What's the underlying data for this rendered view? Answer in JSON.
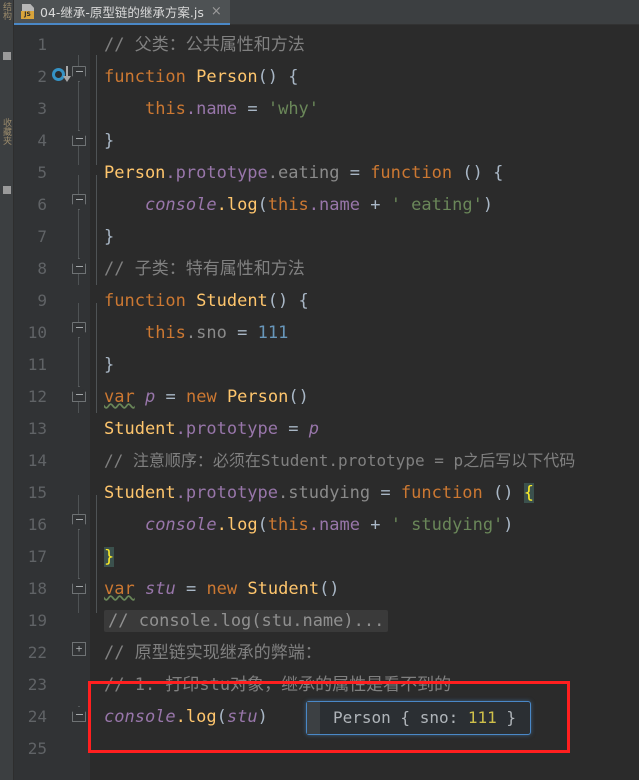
{
  "window": {
    "background": "#2b2b2b",
    "accent": "#4a88c7"
  },
  "left_strip": {
    "labels": [
      "结构",
      "收藏夹"
    ]
  },
  "tab": {
    "title": "04-继承-原型链的继承方案.js",
    "icon": "js-file-icon",
    "badge": "JS",
    "close": "×"
  },
  "gutter": {
    "line_numbers": [
      "1",
      "2",
      "3",
      "4",
      "5",
      "6",
      "7",
      "8",
      "9",
      "10",
      "11",
      "12",
      "13",
      "14",
      "15",
      "16",
      "17",
      "18",
      "19",
      "22",
      "23",
      "24",
      "25"
    ],
    "impl_icon": "implemented-method-icon"
  },
  "editor": {
    "lines": [
      {
        "n": "1",
        "text": "// 父类：公共属性和方法"
      },
      {
        "n": "2",
        "text": "function Person() {"
      },
      {
        "n": "3",
        "text": "    this.name = 'why'"
      },
      {
        "n": "4",
        "text": "}"
      },
      {
        "n": "5",
        "text": "Person.prototype.eating = function () {"
      },
      {
        "n": "6",
        "text": "    console.log(this.name + ' eating')"
      },
      {
        "n": "7",
        "text": "}"
      },
      {
        "n": "8",
        "text": "// 子类：特有属性和方法"
      },
      {
        "n": "9",
        "text": "function Student() {"
      },
      {
        "n": "10",
        "text": "    this.sno = 111"
      },
      {
        "n": "11",
        "text": "}"
      },
      {
        "n": "12",
        "text": "var p = new Person()"
      },
      {
        "n": "13",
        "text": "Student.prototype = p"
      },
      {
        "n": "14",
        "text": "// 注意顺序：必须在Student.prototype = p之后写以下代码"
      },
      {
        "n": "15",
        "text": "Student.prototype.studying = function () {"
      },
      {
        "n": "16",
        "text": "    console.log(this.name + ' studying')"
      },
      {
        "n": "17",
        "text": "}"
      },
      {
        "n": "18",
        "text": "var stu = new Student()"
      },
      {
        "n": "19",
        "text": "// console.log(stu.name)..."
      },
      {
        "n": "22",
        "text": "// 原型链实现继承的弊端："
      },
      {
        "n": "23",
        "text": "// 1. 打印stu对象，继承的属性是看不到的"
      },
      {
        "n": "24",
        "text": "console.log(stu)"
      },
      {
        "n": "25",
        "text": ""
      }
    ],
    "tokens": {
      "l1_comment": "// 父类：公共属性和方法",
      "l2_kw": "function",
      "l2_name": "Person",
      "l2_parens": "()",
      "l2_brace": "{",
      "l3_this": "this",
      "l3_dot_name": ".name",
      "l3_eq": "=",
      "l3_str": "'why'",
      "l4_brace": "}",
      "l5_obj": "Person",
      "l5_proto": ".prototype",
      "l5_member": ".eating",
      "l5_eq": "=",
      "l5_kw": "function",
      "l5_parens": "()",
      "l5_brace": "{",
      "l6_console": "console",
      "l6_log": ".log",
      "l6_open": "(",
      "l6_this": "this",
      "l6_name": ".name",
      "l6_plus": "+",
      "l6_str": "' eating'",
      "l6_close": ")",
      "l7_brace": "}",
      "l8_comment": "// 子类：特有属性和方法",
      "l9_kw": "function",
      "l9_name": "Student",
      "l9_parens": "()",
      "l9_brace": "{",
      "l10_this": "this",
      "l10_sno": ".sno",
      "l10_eq": "=",
      "l10_num": "111",
      "l11_brace": "}",
      "l12_var": "var",
      "l12_p": "p",
      "l12_eq": "=",
      "l12_new": "new",
      "l12_ctor": "Person",
      "l12_parens": "()",
      "l13_obj": "Student",
      "l13_proto": ".prototype",
      "l13_eq": "=",
      "l13_p": "p",
      "l14_comment": "// 注意顺序：必须在Student.prototype = p之后写以下代码",
      "l15_obj": "Student",
      "l15_proto": ".prototype",
      "l15_member": ".studying",
      "l15_eq": "=",
      "l15_kw": "function",
      "l15_parens": "()",
      "l15_brace": "{",
      "l16_console": "console",
      "l16_log": ".log",
      "l16_open": "(",
      "l16_this": "this",
      "l16_name": ".name",
      "l16_plus": "+",
      "l16_str": "' studying'",
      "l16_close": ")",
      "l17_brace": "}",
      "l18_var": "var",
      "l18_stu": "stu",
      "l18_eq": "=",
      "l18_new": "new",
      "l18_ctor": "Student",
      "l18_parens": "()",
      "l19_folded": "// console.log(stu.name)...",
      "l22_comment": "// 原型链实现继承的弊端：",
      "l23_comment": "// 1. 打印stu对象，继承的属性是看不到的",
      "l24_console": "console",
      "l24_log": ".log",
      "l24_open": "(",
      "l24_stu": "stu",
      "l24_close": ")"
    }
  },
  "inline_hint": {
    "prefix": "Person { sno: ",
    "number": "111",
    "suffix": " }"
  },
  "annotation": {
    "color": "#ff1f1f",
    "shape": "rectangle"
  }
}
